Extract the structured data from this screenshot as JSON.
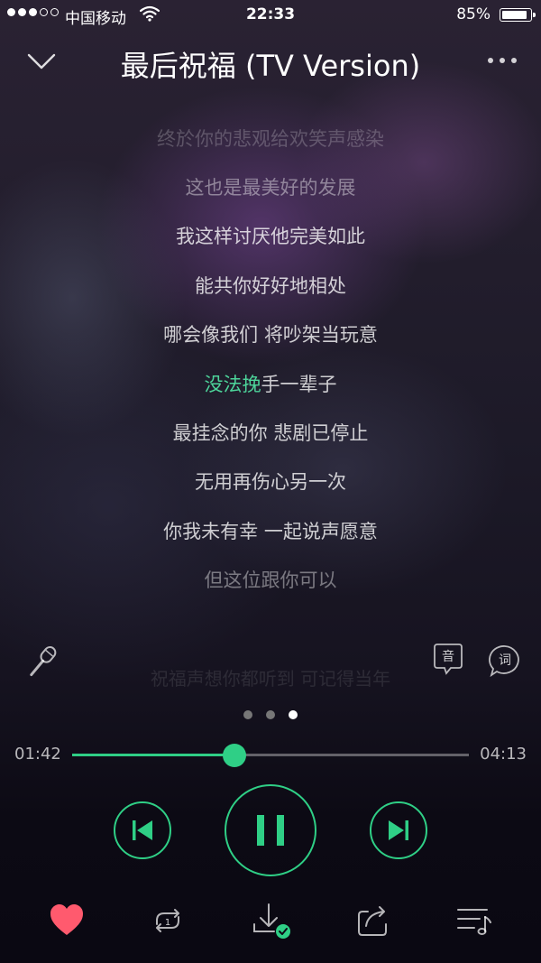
{
  "status_bar": {
    "carrier": "中国移动",
    "time": "22:33",
    "battery": "85%",
    "battery_level": 0.85,
    "signal_bars_filled": 3,
    "signal_bars_total": 5
  },
  "header": {
    "title": "最后祝福 (TV Version)",
    "collapse_icon": "chevron-down-icon",
    "more_icon": "more-dots-icon"
  },
  "lyrics": {
    "lines": [
      "终於你的悲观给欢笑声感染",
      "这也是最美好的发展",
      "我这样讨厌他完美如此",
      "能共你好好地相处",
      "哪会像我们 将吵架当玩意",
      "手一辈子",
      "最挂念的你 悲剧已停止",
      "无用再伤心另一次",
      "你我未有幸 一起说声愿意",
      "但这位跟你可以"
    ],
    "current_highlight": "没法挽",
    "below_line": "祝福声想你都听到 可记得当年",
    "highlight_color": "#4dd49a"
  },
  "tools": {
    "mic_icon": "microphone-icon",
    "yin_label": "音",
    "ci_label": "词"
  },
  "pager": {
    "count": 3,
    "active": 2
  },
  "player": {
    "elapsed": "01:42",
    "total": "04:13",
    "progress": 0.41,
    "accent": "#2fcf86",
    "prev_icon": "previous-track-icon",
    "pause_icon": "pause-icon",
    "next_icon": "next-track-icon"
  },
  "bottom_bar": {
    "items": [
      "heart-icon",
      "repeat-one-icon",
      "download-done-icon",
      "share-icon",
      "playlist-icon"
    ],
    "favorite_color": "#ff5a6e"
  }
}
